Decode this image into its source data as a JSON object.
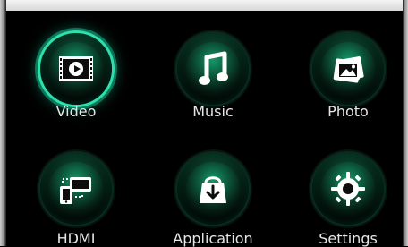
{
  "grid": {
    "items": [
      {
        "id": "video",
        "label": "Video",
        "icon": "video-film-icon"
      },
      {
        "id": "music",
        "label": "Music",
        "icon": "music-note-icon"
      },
      {
        "id": "photo",
        "label": "Photo",
        "icon": "photo-stack-icon"
      },
      {
        "id": "hdmi",
        "label": "HDMI",
        "icon": "hdmi-screens-icon"
      },
      {
        "id": "application",
        "label": "Application",
        "icon": "shopping-bag-download-icon"
      },
      {
        "id": "settings",
        "label": "Settings",
        "icon": "gear-icon"
      }
    ]
  },
  "selection": {
    "active_id": "video"
  },
  "colors": {
    "glow": "#2fffc4",
    "label": "#e6e6e6",
    "background": "#000000"
  }
}
